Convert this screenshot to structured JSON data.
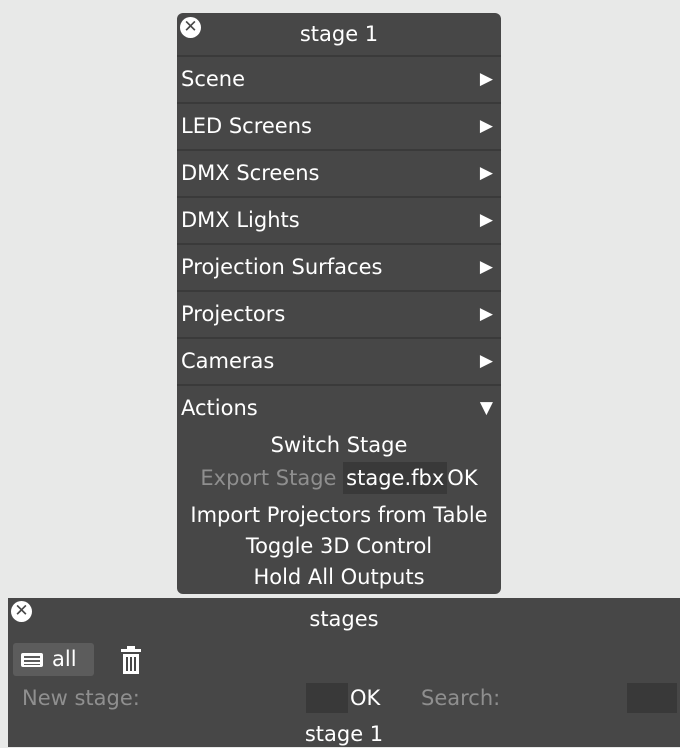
{
  "stage_panel": {
    "title": "stage 1",
    "close_symbol": "✕",
    "menu": [
      {
        "label": "Scene",
        "arrow": "▶"
      },
      {
        "label": "LED Screens",
        "arrow": "▶"
      },
      {
        "label": "DMX Screens",
        "arrow": "▶"
      },
      {
        "label": "DMX Lights",
        "arrow": "▶"
      },
      {
        "label": "Projection Surfaces",
        "arrow": "▶"
      },
      {
        "label": "Projectors",
        "arrow": "▶"
      },
      {
        "label": "Cameras",
        "arrow": "▶"
      },
      {
        "label": "Actions",
        "arrow": "▼"
      }
    ],
    "actions": {
      "switch_stage": "Switch Stage",
      "export_label": "Export Stage",
      "export_filename": "stage.fbx",
      "export_ok": "OK",
      "import_projectors": "Import Projectors from Table",
      "toggle_3d": "Toggle 3D Control",
      "hold_outputs": "Hold All Outputs"
    }
  },
  "stages_panel": {
    "title": "stages",
    "close_symbol": "✕",
    "all_button": "all",
    "new_stage_label": "New stage:",
    "new_stage_value": "",
    "ok_label": "OK",
    "search_label": "Search:",
    "search_value": "",
    "items": [
      "stage 1"
    ]
  },
  "icons": {
    "close": "close-icon",
    "list": "list-icon",
    "trash": "trash-icon"
  },
  "colors": {
    "background": "#e8e9e8",
    "panel": "#474747",
    "field": "#393939",
    "dim_text": "#8f8f8f",
    "text": "#ffffff"
  }
}
